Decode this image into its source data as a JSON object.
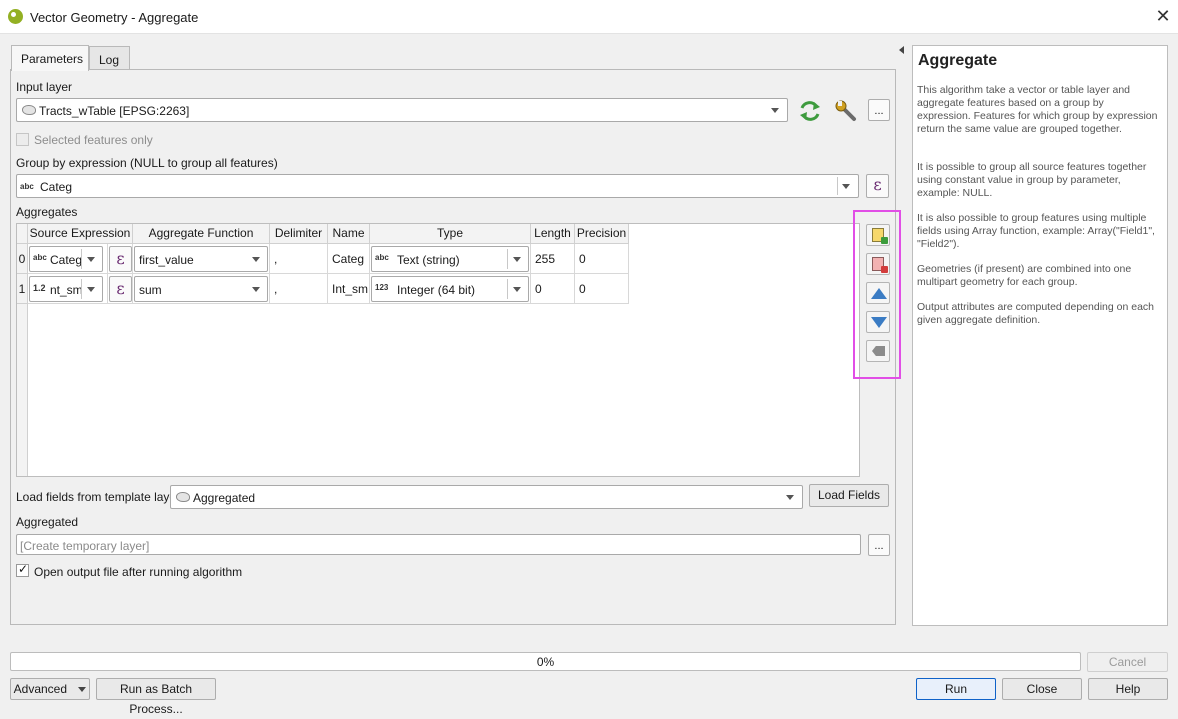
{
  "window": {
    "title": "Vector Geometry - Aggregate",
    "close_glyph": "✕"
  },
  "tabs": [
    {
      "label": "Parameters",
      "active": true
    },
    {
      "label": "Log",
      "active": false
    }
  ],
  "input_layer": {
    "label": "Input layer",
    "value": "Tracts_wTable [EPSG:2263]",
    "selected_only_label": "Selected features only",
    "ellipsis": "..."
  },
  "group_by": {
    "label": "Group by expression (NULL to group all features)",
    "type_glyph": "abc",
    "value": "Categ",
    "epsilon": "ε"
  },
  "aggregates": {
    "label": "Aggregates",
    "columns": [
      "Source Expression",
      "Aggregate Function",
      "Delimiter",
      "Name",
      "Type",
      "Length",
      "Precision"
    ],
    "rows": [
      {
        "index": "0",
        "src_glyph": "abc",
        "src": "Categ",
        "func": "first_value",
        "delimiter": ",",
        "name": "Categ",
        "type_glyph": "abc",
        "type": "Text (string)",
        "length": "255",
        "precision": "0"
      },
      {
        "index": "1",
        "src_glyph": "1.2",
        "src": "nt_sm",
        "func": "sum",
        "delimiter": ",",
        "name": "Int_sm",
        "type_glyph": "123",
        "type": "Integer (64 bit)",
        "length": "0",
        "precision": "0"
      }
    ]
  },
  "template": {
    "label": "Load fields from template layer",
    "value": "Aggregated",
    "button": "Load Fields"
  },
  "output": {
    "label": "Aggregated",
    "placeholder": "[Create temporary layer]",
    "ellipsis": "...",
    "open_after_label": "Open output file after running algorithm",
    "open_after_checked": true
  },
  "help": {
    "title": "Aggregate",
    "paragraphs": [
      "This algorithm take a vector or table layer and aggregate features based on a group by expression. Features for which group by expression return the same value are grouped together.",
      "It is possible to group all source features together using constant value in group by parameter, example: NULL.",
      "It is also possible to group features using multiple fields using Array function, example: Array(\"Field1\", \"Field2\").",
      "Geometries (if present) are combined into one multipart geometry for each group.",
      "Output attributes are computed depending on each given aggregate definition."
    ]
  },
  "progress": {
    "text": "0%",
    "percent": 0
  },
  "buttons": {
    "cancel": "Cancel",
    "advanced": "Advanced",
    "batch": "Run as Batch Process...",
    "run": "Run",
    "close": "Close",
    "help": "Help"
  },
  "colors": {
    "highlight": "#e14ee6",
    "accent": "#0f62c8",
    "epsilon": "#6d2f74",
    "qgis_green": "#93b023"
  }
}
